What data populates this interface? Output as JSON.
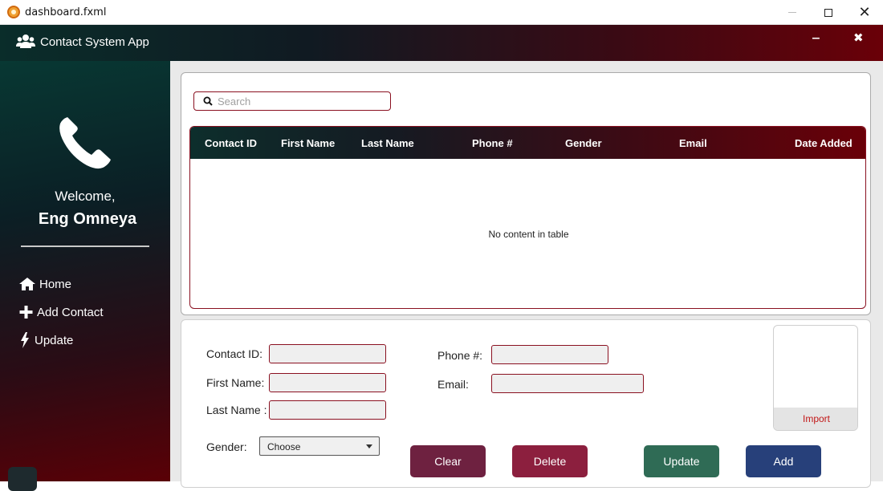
{
  "window": {
    "title": "dashboard.fxml"
  },
  "header": {
    "app_name": "Contact System App",
    "minimize_glyph": "‒",
    "close_glyph": "✖"
  },
  "sidebar": {
    "welcome": "Welcome,",
    "user_name": "Eng Omneya",
    "items": [
      {
        "label": "Home",
        "icon": "home-icon"
      },
      {
        "label": "Add Contact",
        "icon": "plus-icon"
      },
      {
        "label": "Update",
        "icon": "bolt-icon"
      }
    ]
  },
  "search": {
    "placeholder": "Search",
    "value": ""
  },
  "table": {
    "columns": [
      "Contact ID",
      "First Name",
      "Last Name",
      "Phone #",
      "Gender",
      "Email",
      "Date Added"
    ],
    "empty_message": "No content in table"
  },
  "form": {
    "contact_id_label": "Contact ID:",
    "first_name_label": "First Name:",
    "last_name_label": "Last Name :",
    "gender_label": "Gender:",
    "gender_selected": "Choose",
    "phone_label": "Phone #:",
    "email_label": "Email:",
    "import_label": "Import"
  },
  "buttons": {
    "clear": "Clear",
    "delete": "Delete",
    "update": "Update",
    "add": "Add"
  },
  "colors": {
    "accent": "#8a1020",
    "header_start": "#0a2d2a",
    "header_end": "#6a0008"
  }
}
